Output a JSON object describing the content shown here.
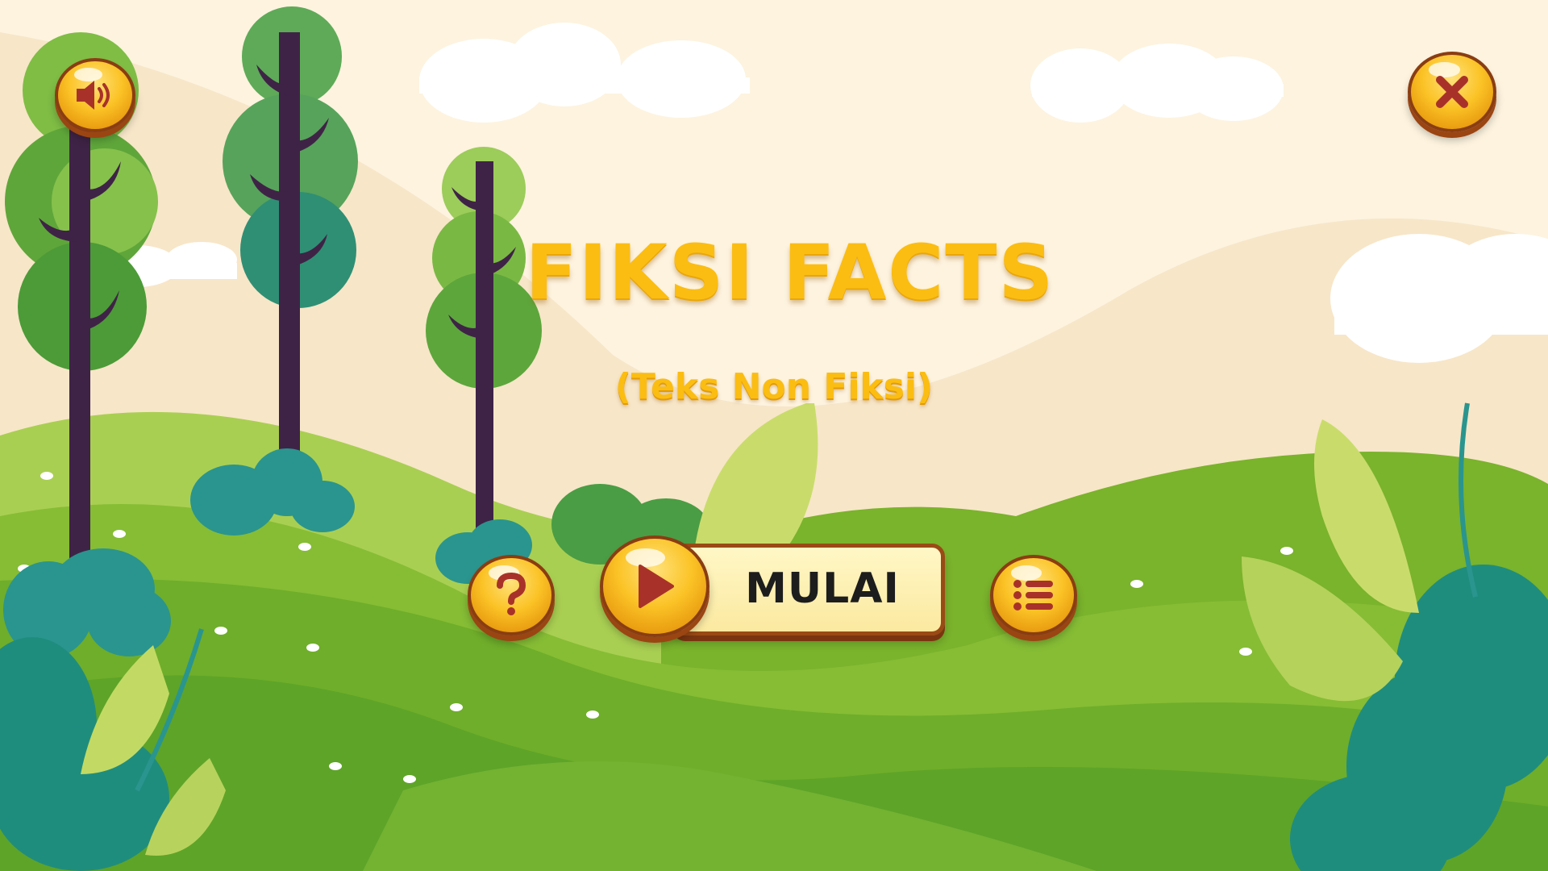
{
  "game": {
    "title": "FIKSI FACTS",
    "subtitle": "(Teks Non Fiksi)",
    "start_label": "MULAI"
  },
  "buttons": {
    "sound": {
      "icon": "speaker-volume-icon"
    },
    "close": {
      "icon": "close-x-icon"
    },
    "help": {
      "icon": "question-mark-icon"
    },
    "start": {
      "icon": "play-icon"
    },
    "menu": {
      "icon": "list-icon"
    }
  },
  "colors": {
    "title": "#fbbd12",
    "button_gold": "#fbc326",
    "button_outline": "#8a3d12",
    "icon_red": "#a8322a",
    "sky": "#fdf3df",
    "grass": "#7cb82f"
  }
}
